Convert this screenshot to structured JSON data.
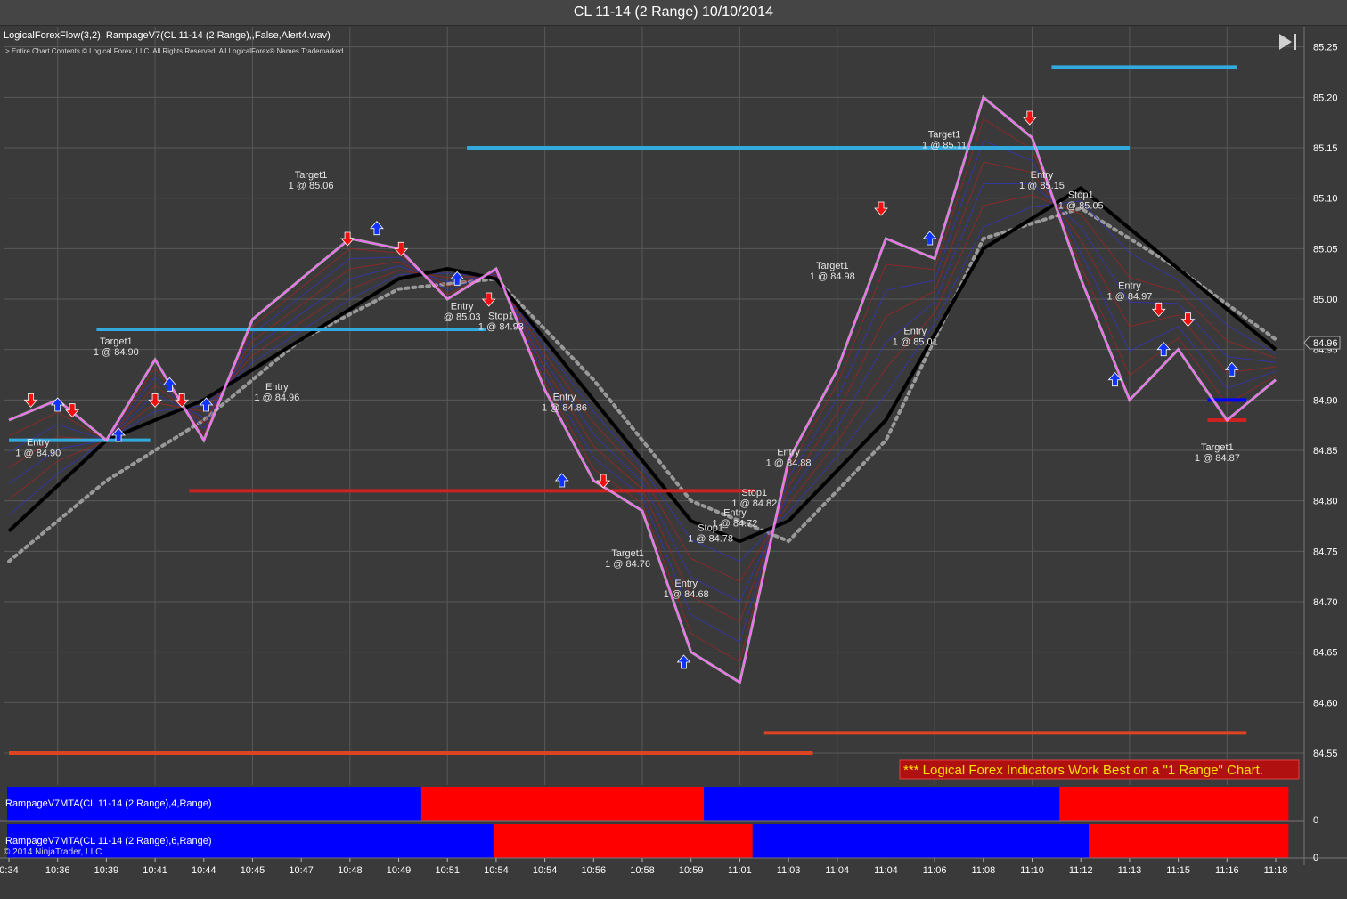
{
  "window": {
    "title": "CL 11-14 (2 Range)  10/10/2014"
  },
  "indicators_label": "LogicalForexFlow(3,2),  RampageV7(CL 11-14 (2 Range),,False,Alert4.wav)",
  "copyright_notice": "> Entire Chart Contents © Logical Forex, LLC. All Rights Reserved. All LogicalForex® Names Trademarked.",
  "footer_copyright": "© 2014 NinjaTrader, LLC",
  "banner": "*** Logical Forex Indicators Work Best on a \"1 Range\" Chart.",
  "price_badge": "84.96",
  "panels": [
    {
      "label": "RampageV7MTA(CL 11-14 (2 Range),4,Range)",
      "axis_value": "0"
    },
    {
      "label": "RampageV7MTA(CL 11-14 (2 Range),6,Range)",
      "axis_value": "0"
    }
  ],
  "colors": {
    "background": "#3a3a3a",
    "grid": "#585858",
    "price_line": "#ff66ff",
    "bull": "#0000ff",
    "bear": "#ff0000",
    "trend": "#000000",
    "trail": "#999999",
    "level_blue": "#33aadd",
    "level_red": "#cc2222",
    "banner_bg": "#b01010",
    "banner_text": "#ffe000"
  },
  "chart_data": {
    "type": "line",
    "title": "CL 11-14 (2 Range)  10/10/2014",
    "y_axis": {
      "ylim": [
        84.52,
        85.27
      ],
      "ticks": [
        "85.25",
        "85.20",
        "85.15",
        "85.10",
        "85.05",
        "85.00",
        "84.95",
        "84.90",
        "84.85",
        "84.80",
        "84.75",
        "84.70",
        "84.65",
        "84.60",
        "84.55"
      ]
    },
    "x_axis": {
      "ticks": [
        "0:34",
        "10:36",
        "10:39",
        "10:41",
        "10:44",
        "10:45",
        "10:47",
        "10:48",
        "10:49",
        "10:51",
        "10:54",
        "10:54",
        "10:56",
        "10:58",
        "10:59",
        "11:01",
        "11:03",
        "11:04",
        "11:04",
        "11:06",
        "11:08",
        "11:10",
        "11:12",
        "11:13",
        "11:15",
        "11:16",
        "11:18"
      ]
    },
    "grid": true,
    "series": [
      {
        "name": "price",
        "color": "#ff66ff",
        "x": [
          0,
          1,
          2,
          3,
          4,
          5,
          6,
          7,
          8,
          9,
          10,
          11,
          12,
          13,
          14,
          15,
          16,
          17,
          18,
          19,
          20,
          21,
          22,
          23,
          24,
          25,
          26
        ],
        "y": [
          84.88,
          84.9,
          84.86,
          84.94,
          84.86,
          84.98,
          85.02,
          85.06,
          85.05,
          85.0,
          85.03,
          84.91,
          84.82,
          84.79,
          84.65,
          84.62,
          84.84,
          84.93,
          85.06,
          85.04,
          85.2,
          85.16,
          85.02,
          84.9,
          84.95,
          84.88,
          84.92
        ]
      },
      {
        "name": "trend",
        "color": "#000000",
        "x": [
          0,
          2,
          4,
          6,
          8,
          9,
          10,
          12,
          14,
          15,
          16,
          18,
          20,
          22,
          24,
          26
        ],
        "y": [
          84.77,
          84.86,
          84.9,
          84.96,
          85.02,
          85.03,
          85.02,
          84.9,
          84.78,
          84.76,
          84.78,
          84.88,
          85.05,
          85.11,
          85.03,
          84.95
        ]
      },
      {
        "name": "trail",
        "color": "#999999",
        "x": [
          0,
          2,
          4,
          6,
          8,
          10,
          12,
          14,
          16,
          18,
          20,
          22,
          24,
          26
        ],
        "y": [
          84.74,
          84.82,
          84.88,
          84.96,
          85.01,
          85.02,
          84.92,
          84.8,
          84.76,
          84.86,
          85.06,
          85.09,
          85.03,
          84.96
        ]
      }
    ],
    "levels": [
      {
        "y": 85.23,
        "x_from": 21.4,
        "x_to": 25.2,
        "color": "#33aadd"
      },
      {
        "y": 85.15,
        "x_from": 9.4,
        "x_to": 23.0,
        "color": "#33aadd"
      },
      {
        "y": 84.97,
        "x_from": 1.8,
        "x_to": 9.8,
        "color": "#33aadd"
      },
      {
        "y": 84.86,
        "x_from": 0.0,
        "x_to": 2.9,
        "color": "#33aadd"
      },
      {
        "y": 84.81,
        "x_from": 3.7,
        "x_to": 15.3,
        "color": "#cc2222"
      },
      {
        "y": 84.57,
        "x_from": 15.5,
        "x_to": 25.4,
        "color": "#dd4422"
      },
      {
        "y": 84.55,
        "x_from": 0.0,
        "x_to": 16.5,
        "color": "#dd4422"
      },
      {
        "y": 84.9,
        "x_from": 24.6,
        "x_to": 25.4,
        "color": "#0000ff"
      },
      {
        "y": 84.88,
        "x_from": 24.6,
        "x_to": 25.4,
        "color": "#cc2222"
      }
    ],
    "annotations": [
      {
        "lines": [
          "Entry",
          "1 @ 84.90"
        ],
        "x": 0.6,
        "y": 84.855
      },
      {
        "lines": [
          "Target1",
          "1 @ 84.90"
        ],
        "x": 2.2,
        "y": 84.955
      },
      {
        "lines": [
          "Entry",
          "1 @ 84.96"
        ],
        "x": 5.5,
        "y": 84.91
      },
      {
        "lines": [
          "Target1",
          "1 @ 85.06"
        ],
        "x": 6.2,
        "y": 85.12
      },
      {
        "lines": [
          "Entry",
          "@ 85.03"
        ],
        "x": 9.3,
        "y": 84.99
      },
      {
        "lines": [
          "Stop1",
          "1 @ 84.93"
        ],
        "x": 10.1,
        "y": 84.98
      },
      {
        "lines": [
          "Entry",
          "1 @ 84.86"
        ],
        "x": 11.4,
        "y": 84.9
      },
      {
        "lines": [
          "Target1",
          "1 @ 84.76"
        ],
        "x": 12.7,
        "y": 84.745
      },
      {
        "lines": [
          "Entry",
          "1 @ 84.68"
        ],
        "x": 13.9,
        "y": 84.715
      },
      {
        "lines": [
          "Stop1",
          "1 @ 84.78"
        ],
        "x": 14.4,
        "y": 84.77
      },
      {
        "lines": [
          "Entry",
          "1 @ 84.72"
        ],
        "x": 14.9,
        "y": 84.785
      },
      {
        "lines": [
          "Stop1",
          "1 @ 84.82"
        ],
        "x": 15.3,
        "y": 84.805
      },
      {
        "lines": [
          "Entry",
          "1 @ 84.88"
        ],
        "x": 16.0,
        "y": 84.845
      },
      {
        "lines": [
          "Target1",
          "1 @ 84.98"
        ],
        "x": 16.9,
        "y": 85.03
      },
      {
        "lines": [
          "Entry",
          "1 @ 85.01"
        ],
        "x": 18.6,
        "y": 84.965
      },
      {
        "lines": [
          "Target1",
          "1 @ 85.11"
        ],
        "x": 19.2,
        "y": 85.16
      },
      {
        "lines": [
          "Entry",
          "1 @ 85.15"
        ],
        "x": 21.2,
        "y": 85.12
      },
      {
        "lines": [
          "Stop1",
          "1 @ 85.05"
        ],
        "x": 22.0,
        "y": 85.1
      },
      {
        "lines": [
          "Entry",
          "1 @ 84.97"
        ],
        "x": 23.0,
        "y": 85.01
      },
      {
        "lines": [
          "Target1",
          "1 @ 84.87"
        ],
        "x": 24.8,
        "y": 84.85
      }
    ],
    "signals": [
      {
        "dir": "down",
        "x": 0.45,
        "y": 84.9
      },
      {
        "dir": "up",
        "x": 1.0,
        "y": 84.895
      },
      {
        "dir": "down",
        "x": 1.3,
        "y": 84.89
      },
      {
        "dir": "up",
        "x": 2.25,
        "y": 84.865
      },
      {
        "dir": "down",
        "x": 3.0,
        "y": 84.9
      },
      {
        "dir": "up",
        "x": 3.3,
        "y": 84.915
      },
      {
        "dir": "down",
        "x": 3.55,
        "y": 84.9
      },
      {
        "dir": "up",
        "x": 4.05,
        "y": 84.895
      },
      {
        "dir": "down",
        "x": 6.95,
        "y": 85.06
      },
      {
        "dir": "up",
        "x": 7.55,
        "y": 85.07
      },
      {
        "dir": "down",
        "x": 8.05,
        "y": 85.05
      },
      {
        "dir": "up",
        "x": 9.2,
        "y": 85.02
      },
      {
        "dir": "down",
        "x": 9.85,
        "y": 85.0
      },
      {
        "dir": "up",
        "x": 11.35,
        "y": 84.82
      },
      {
        "dir": "down",
        "x": 12.2,
        "y": 84.82
      },
      {
        "dir": "up",
        "x": 13.85,
        "y": 84.64
      },
      {
        "dir": "down",
        "x": 17.9,
        "y": 85.09
      },
      {
        "dir": "up",
        "x": 18.9,
        "y": 85.06
      },
      {
        "dir": "down",
        "x": 20.95,
        "y": 85.18
      },
      {
        "dir": "up",
        "x": 22.7,
        "y": 84.92
      },
      {
        "dir": "down",
        "x": 23.6,
        "y": 84.99
      },
      {
        "dir": "up",
        "x": 23.7,
        "y": 84.95
      },
      {
        "dir": "down",
        "x": 24.2,
        "y": 84.98
      },
      {
        "dir": "up",
        "x": 25.1,
        "y": 84.93
      }
    ],
    "mta_panels": [
      {
        "segments": [
          {
            "color": "#0000ff",
            "from": 0.0,
            "to": 8.5
          },
          {
            "color": "#ff0000",
            "from": 8.5,
            "to": 14.3
          },
          {
            "color": "#0000ff",
            "from": 14.3,
            "to": 21.6
          },
          {
            "color": "#ff0000",
            "from": 21.6,
            "to": 26.3
          }
        ]
      },
      {
        "segments": [
          {
            "color": "#0000ff",
            "from": 0.0,
            "to": 10.0
          },
          {
            "color": "#ff0000",
            "from": 10.0,
            "to": 15.3
          },
          {
            "color": "#0000ff",
            "from": 15.3,
            "to": 22.2
          },
          {
            "color": "#ff0000",
            "from": 22.2,
            "to": 26.3
          }
        ]
      }
    ]
  }
}
